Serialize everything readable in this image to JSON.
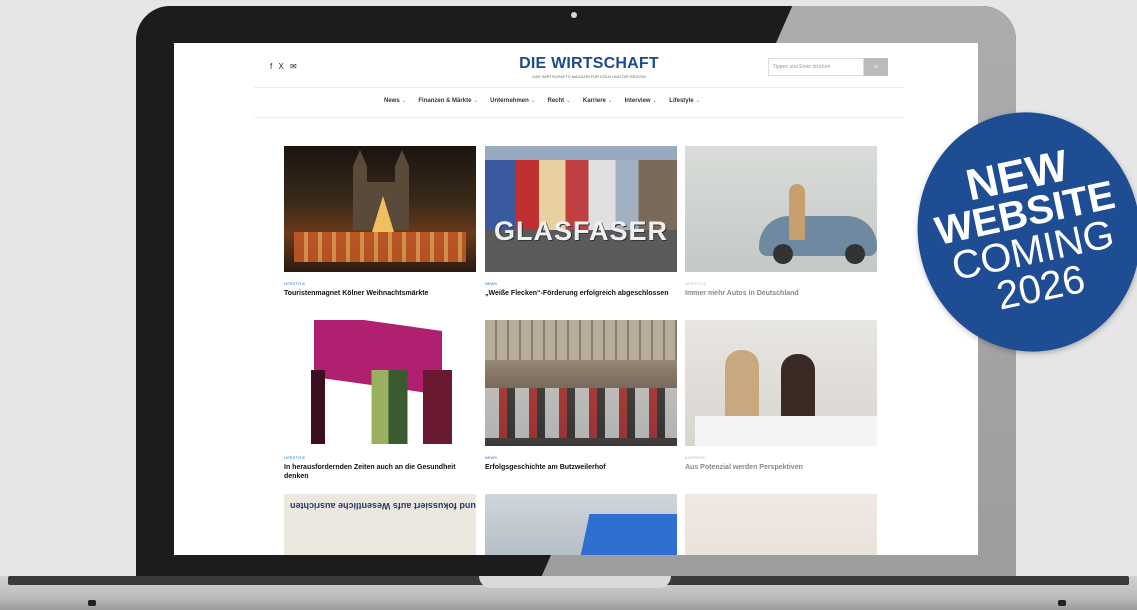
{
  "site": {
    "social_icons": [
      "facebook-icon",
      "x-icon",
      "mail-icon"
    ],
    "social_text": "f X ✉",
    "logo": "DIE WIRTSCHAFT",
    "logo_sub": "DAS WIRTSCHAFTS MAGAZIN FÜR KÖLN UND DIE REGION",
    "search_placeholder": "Tippen und Enter drücken",
    "search_icon": "search-icon"
  },
  "nav": [
    "News",
    "Finanzen & Märkte",
    "Unternehmen",
    "Recht",
    "Karriere",
    "Interview",
    "Lifestyle"
  ],
  "articles": [
    {
      "category": "Lifestyle",
      "title": "Touristenmagnet Kölner Weihnachtsmärkte"
    },
    {
      "category": "News",
      "title": "„Weiße Flecken“-Förderung erfolgreich abgeschlossen",
      "overlay": "GLASFASER"
    },
    {
      "category": "Lifestyle",
      "title": "Immer mehr Autos in Deutschland"
    },
    {
      "category": "Lifestyle",
      "title": "In herausfordernden Zeiten auch an die Gesundheit denken"
    },
    {
      "category": "News",
      "title": "Erfolgsgeschichte am Butzweilerhof"
    },
    {
      "category": "Karriere",
      "title": "Aus Potenzial werden Perspektiven"
    },
    {
      "category": "",
      "title": "",
      "overlay": "LEADERS · Führung klar und fokussiert aufs Wesentliche ausrichten"
    },
    {
      "category": "",
      "title": ""
    },
    {
      "category": "",
      "title": ""
    }
  ],
  "badge": {
    "line1": "NEW",
    "line2": "WEBSITE",
    "line3": "COMING",
    "line4": "2026"
  }
}
